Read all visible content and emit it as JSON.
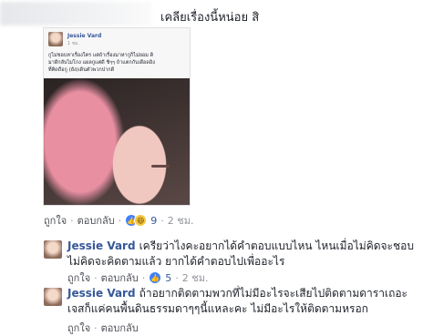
{
  "top_comment": {
    "text": "เคลียเรื่องนี้หน่อย สิ",
    "meta": {
      "like": "ถูกใจ",
      "reply": "ตอบกลับ",
      "count": "9",
      "time": "2 ชม."
    }
  },
  "shared_post": {
    "author": "Jessie Vard",
    "time": "1 ชม.",
    "text": "กูไม่ชอบหาเรื่องใคร แต่ถ้าเรื่องมาหากูก็ไม่ยอม ดิ\nมาดีกลับไม่โกง แผลกูแต่ดี ชิๆๆ ถ้าแตกกับเดือดอิง\nที่คิดถือกู (ยัง)เดินตัวพวกปากดี"
  },
  "replies": [
    {
      "author": "Jessie Vard",
      "text": "เครียว่าไงคะอยากได้คำตอบแบบไหน ไหนเมื่อไม่คิดจะชอบไม่คิดจะคิดตามแล้ว ยากได้คำตอบไปเพื่ออะไร",
      "meta": {
        "like": "ถูกใจ",
        "reply": "ตอบกลับ",
        "count": "5",
        "time": "2 ชม."
      }
    },
    {
      "author": "Jessie Vard",
      "text": "ถ้าอยากติดตามพวกที่ไม่มีอะไรจะเสียไปติดตามดาราเถอะเจสก็แค่คนพื้นดินธรรมดาๆๆนี้แหละคะ ไม่มีอะไรให้ติดตามหรอก",
      "meta": {
        "like": "ถูกใจ",
        "reply": "ตอบกลับ"
      }
    }
  ]
}
